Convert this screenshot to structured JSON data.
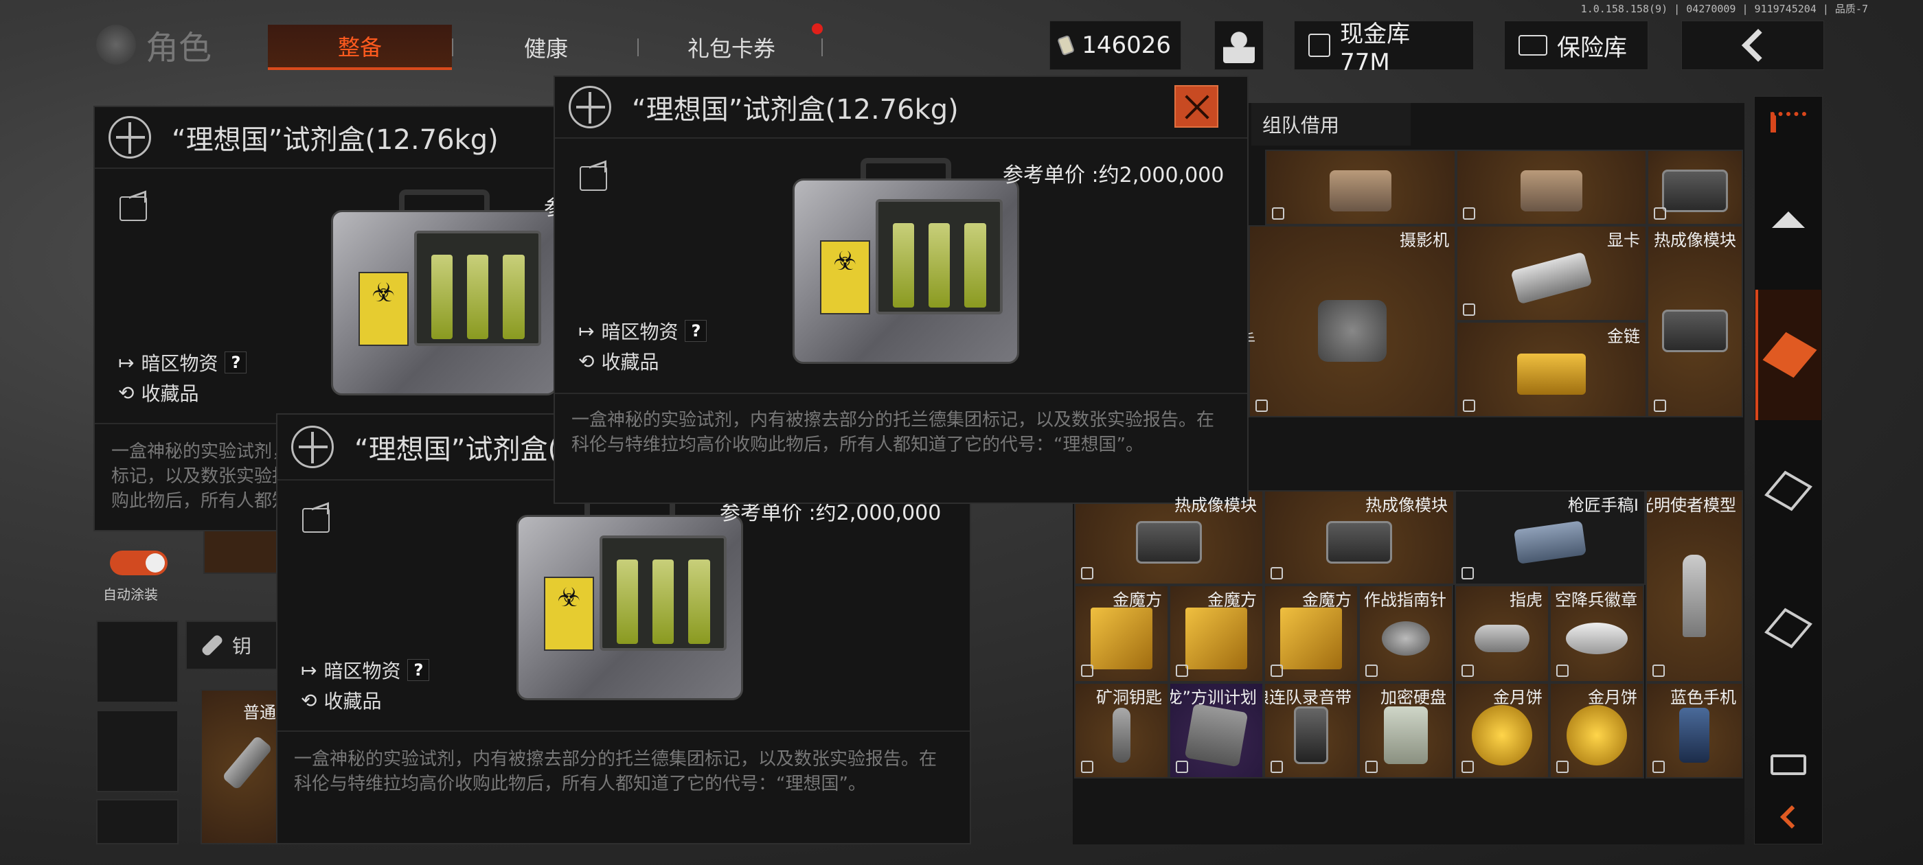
{
  "build_info": "1.0.158.158(9) | 04270009 | 9119745204 | 品质-7",
  "header": {
    "section_title": "角色",
    "tabs": [
      {
        "label": "整备",
        "active": true
      },
      {
        "label": "健康",
        "active": false
      },
      {
        "label": "礼包卡券",
        "active": false,
        "badge": true
      }
    ],
    "currency_amount": "146026",
    "cash_vault_label": "现金库 77M",
    "safe_label": "保险库"
  },
  "item_panel": {
    "title": "“理想国”试剂盒(12.76kg)",
    "price_label": "参考单价 :约2,000,000",
    "tag_darkzone": "暗区物资",
    "tag_help": "?",
    "tag_collectible": "收藏品",
    "description": "一盒神秘的实验试剂，内有被擦去部分的托兰德集团标记，以及数张实验报告。在科伦与特维拉均高价收购此物后，所有人都知道了它的代号：“理想国”。"
  },
  "left_sidebar": {
    "auto_paint_label": "自动涂装",
    "key_label": "钥",
    "item_label": "普通"
  },
  "inventory": {
    "tab_label": "组队借用",
    "rows_top": [
      {
        "name": "",
        "kind": "binoculars"
      },
      {
        "name": "",
        "kind": "binoculars"
      },
      {
        "name": "",
        "kind": "thermal"
      }
    ],
    "rows_mid": [
      {
        "name": "摄影机",
        "kind": "camera"
      },
      {
        "name": "显卡",
        "kind": "gpu"
      },
      {
        "name": "热成像模块",
        "kind": "thermal"
      },
      {
        "name": "金链",
        "kind": "chain"
      }
    ],
    "mid_side_label": "手",
    "row3": [
      {
        "name": "热成像模块",
        "kind": "thermal"
      },
      {
        "name": "热成像模块",
        "kind": "thermal"
      },
      {
        "name": "枪匠手稿I",
        "kind": "paper"
      },
      {
        "name": "光明使者模型",
        "kind": "rocket"
      }
    ],
    "row4": [
      {
        "name": "金魔方",
        "kind": "cube"
      },
      {
        "name": "金魔方",
        "kind": "cube"
      },
      {
        "name": "金魔方",
        "kind": "cube"
      },
      {
        "name": "作战指南针",
        "kind": "compass"
      },
      {
        "name": "指虎",
        "kind": "knuckle"
      },
      {
        "name": "空降兵徽章",
        "kind": "badge"
      }
    ],
    "row5": [
      {
        "name": "矿洞钥匙",
        "kind": "key"
      },
      {
        "name": "“科伦之龙”方训计划",
        "kind": "book"
      },
      {
        "name": "白狼连队录音带",
        "kind": "tape"
      },
      {
        "name": "加密硬盘",
        "kind": "drive"
      },
      {
        "name": "金月饼",
        "kind": "coin"
      },
      {
        "name": "金月饼",
        "kind": "coin"
      },
      {
        "name": "蓝色手机",
        "kind": "phone"
      }
    ]
  }
}
